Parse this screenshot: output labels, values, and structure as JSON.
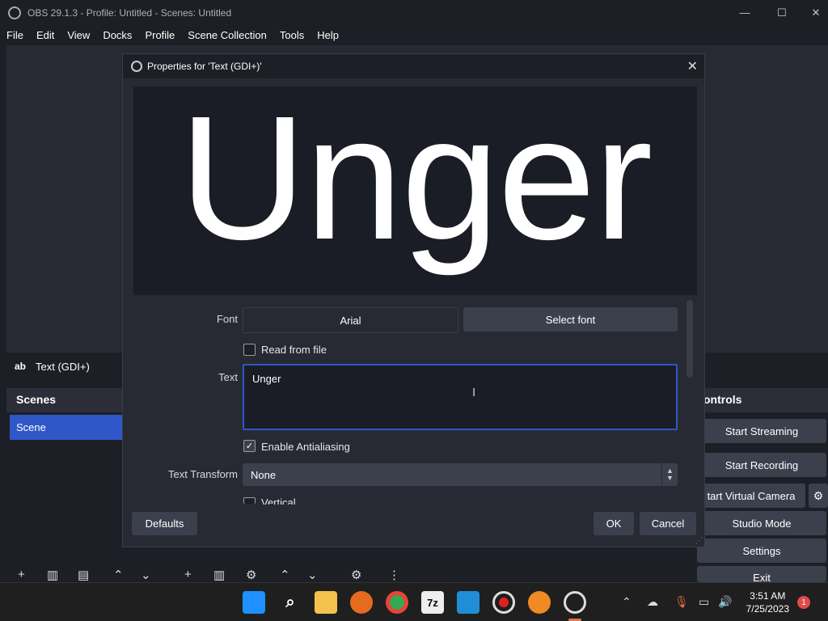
{
  "window": {
    "title": "OBS 29.1.3 - Profile: Untitled - Scenes: Untitled",
    "minimize": "—",
    "maximize": "☐",
    "close": "✕"
  },
  "menu": [
    "File",
    "Edit",
    "View",
    "Docks",
    "Profile",
    "Scene Collection",
    "Tools",
    "Help"
  ],
  "source_bar": {
    "icon": "ab",
    "label": "Text (GDI+)"
  },
  "scenes": {
    "header": "Scenes",
    "items": [
      "Scene"
    ]
  },
  "controls": {
    "header": "ontrols",
    "buttons": [
      "Start Streaming",
      "Start Recording",
      "tart Virtual Camera",
      "Studio Mode",
      "Settings",
      "Exit"
    ]
  },
  "dialog": {
    "title": "Properties for 'Text (GDI+)'",
    "preview_text": "Unger",
    "font_label": "Font",
    "font_value": "Arial",
    "select_font": "Select font",
    "read_from_file": "Read from file",
    "read_from_file_checked": false,
    "text_label": "Text",
    "text_value": "Unger",
    "antialias": "Enable Antialiasing",
    "antialias_checked": true,
    "transform_label": "Text Transform",
    "transform_value": "None",
    "vertical": "Vertical",
    "defaults": "Defaults",
    "ok": "OK",
    "cancel": "Cancel"
  },
  "taskbar": {
    "time": "3:51 AM",
    "date": "7/25/2023",
    "notifications": "1",
    "apps": [
      "start-icon",
      "search-icon",
      "file-explorer-icon",
      "firefox-icon",
      "chrome-icon",
      "7zip-icon",
      "video-editor-icon",
      "record-icon",
      "fl-studio-icon",
      "obs-icon"
    ]
  },
  "colors": {
    "accent": "#2f57c8",
    "background": "#1d1f26",
    "panel": "#272a33",
    "button": "#3c404d"
  }
}
